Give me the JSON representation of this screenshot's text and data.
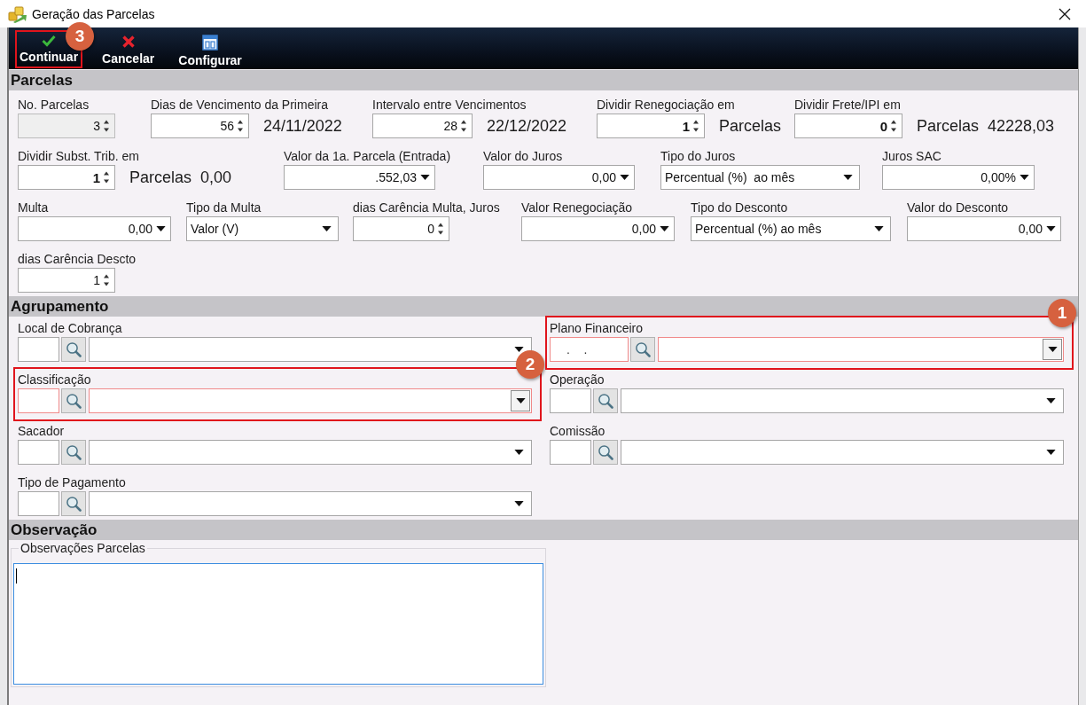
{
  "window": {
    "title": "Geração das Parcelas"
  },
  "toolbar": [
    {
      "kind": "confirm",
      "label": "Continuar",
      "callout": "3"
    },
    {
      "kind": "cancel",
      "label": "Cancelar"
    },
    {
      "kind": "configure",
      "label": "Configurar"
    }
  ],
  "parcelas": {
    "title": "Parcelas",
    "rows": [
      [
        {
          "kind": "spinner",
          "label": "No. Parcelas",
          "value": "3",
          "bold": false,
          "disabled": true
        },
        {
          "kind": "spinner",
          "label": "Dias de Vencimento da Primeira",
          "value": "56",
          "bold": false,
          "disabled": false,
          "after": [
            "24/11/2022"
          ]
        },
        {
          "kind": "spinner",
          "label": "Intervalo entre Vencimentos",
          "value": "28",
          "bold": false,
          "disabled": false,
          "after": [
            "22/12/2022"
          ]
        },
        {
          "kind": "spinner",
          "label": "Dividir Renegociação em",
          "value": "1",
          "bold": true,
          "disabled": false,
          "after": [
            "Parcelas"
          ]
        },
        {
          "kind": "spinner",
          "label": "Dividir Frete/IPI em",
          "value": "0",
          "bold": true,
          "disabled": false,
          "after": [
            "Parcelas",
            "42228,03"
          ]
        }
      ],
      [
        {
          "kind": "spinner",
          "label": "Dividir Subst. Trib. em",
          "value": "1",
          "bold": true,
          "disabled": false,
          "after": [
            "Parcelas",
            "0,00"
          ]
        },
        {
          "kind": "amount",
          "label": "Valor da 1a. Parcela (Entrada)",
          "value": ".552,03",
          "disabled": false
        },
        {
          "kind": "amount",
          "label": "Valor do Juros",
          "value": "0,00",
          "disabled": false
        },
        {
          "kind": "select",
          "label": "Tipo do Juros",
          "value": "Percentual (%)  ao mês",
          "disabled": false
        },
        {
          "kind": "amount",
          "label": "Juros SAC",
          "value": "0,00%",
          "disabled": false
        }
      ],
      [
        {
          "kind": "amount",
          "label": "Multa",
          "value": "0,00",
          "disabled": false
        },
        {
          "kind": "select",
          "label": "Tipo da Multa",
          "value": "Valor (V)",
          "disabled": false
        },
        {
          "kind": "spinner",
          "label": "dias Carência Multa, Juros",
          "value": "0",
          "bold": false,
          "disabled": false
        },
        {
          "kind": "amount",
          "label": "Valor Renegociação",
          "value": "0,00",
          "disabled": false
        },
        {
          "kind": "select",
          "label": "Tipo do Desconto",
          "value": "Percentual (%) ao mês",
          "disabled": false
        },
        {
          "kind": "amount",
          "label": "Valor do Desconto",
          "value": "0,00",
          "disabled": false
        }
      ],
      [
        {
          "kind": "spinner",
          "label": "dias Carência Descto",
          "value": "1",
          "bold": false,
          "disabled": false
        }
      ]
    ]
  },
  "agrupamento": {
    "title": "Agrupamento",
    "columns": [
      [
        {
          "kind": "plain",
          "label": "Local de Cobrança",
          "required": false
        },
        {
          "kind": "plain",
          "label": "Classificação",
          "required": true,
          "callout": "2"
        },
        {
          "kind": "plain",
          "label": "Sacador",
          "required": false
        },
        {
          "kind": "plain",
          "label": "Tipo de Pagamento",
          "required": false
        }
      ],
      [
        {
          "kind": "masked",
          "label": "Plano Financeiro",
          "code": ".    .",
          "required": true,
          "callout": "1"
        },
        {
          "kind": "plain",
          "label": "Operação",
          "required": false
        },
        {
          "kind": "plain",
          "label": "Comissão",
          "required": false
        }
      ]
    ]
  },
  "observacao": {
    "title": "Observação",
    "group_label": "Observações Parcelas",
    "notes": {
      "focused": true
    }
  }
}
